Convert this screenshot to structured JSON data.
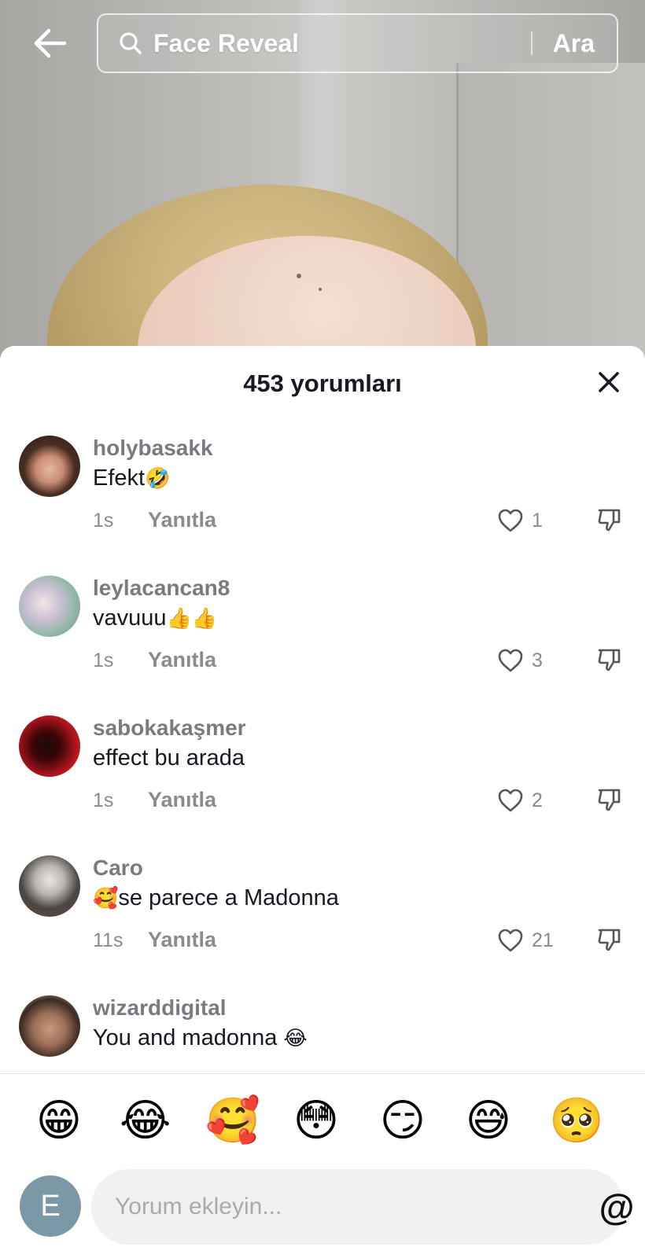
{
  "search": {
    "query": "Face Reveal",
    "button_label": "Ara"
  },
  "sheet": {
    "title": "453 yorumları"
  },
  "comments": [
    {
      "username": "holybasakk",
      "text": "Efekt",
      "emoji": "🤣",
      "time": "1s",
      "reply_label": "Yanıtla",
      "likes": "1",
      "avatar_color": "#3b2a22"
    },
    {
      "username": "leylacancan8",
      "text": "vavuuu",
      "emoji": "👍👍",
      "time": "1s",
      "reply_label": "Yanıtla",
      "likes": "3",
      "avatar_color": "#8fb9a8"
    },
    {
      "username": "sabokakaşmer",
      "text": "effect bu arada",
      "emoji": "",
      "time": "1s",
      "reply_label": "Yanıtla",
      "likes": "2",
      "avatar_color": "#7a0c12"
    },
    {
      "username": "Caro",
      "prefix_emoji": "🥰",
      "text": "se parece a Madonna",
      "emoji": "",
      "time": "11s",
      "reply_label": "Yanıtla",
      "likes": "21",
      "avatar_color": "#5b5754"
    },
    {
      "username": "wizarddigital",
      "text": "You and madonna ",
      "emoji": "😂",
      "time": "",
      "reply_label": "",
      "likes": "",
      "avatar_color": "#6a5a4c"
    }
  ],
  "emoji_bar": [
    "😁",
    "😂",
    "🥰",
    "😳",
    "😏",
    "😅",
    "🥺"
  ],
  "composer": {
    "user_initial": "E",
    "placeholder": "Yorum ekleyin...",
    "at_symbol": "@"
  }
}
